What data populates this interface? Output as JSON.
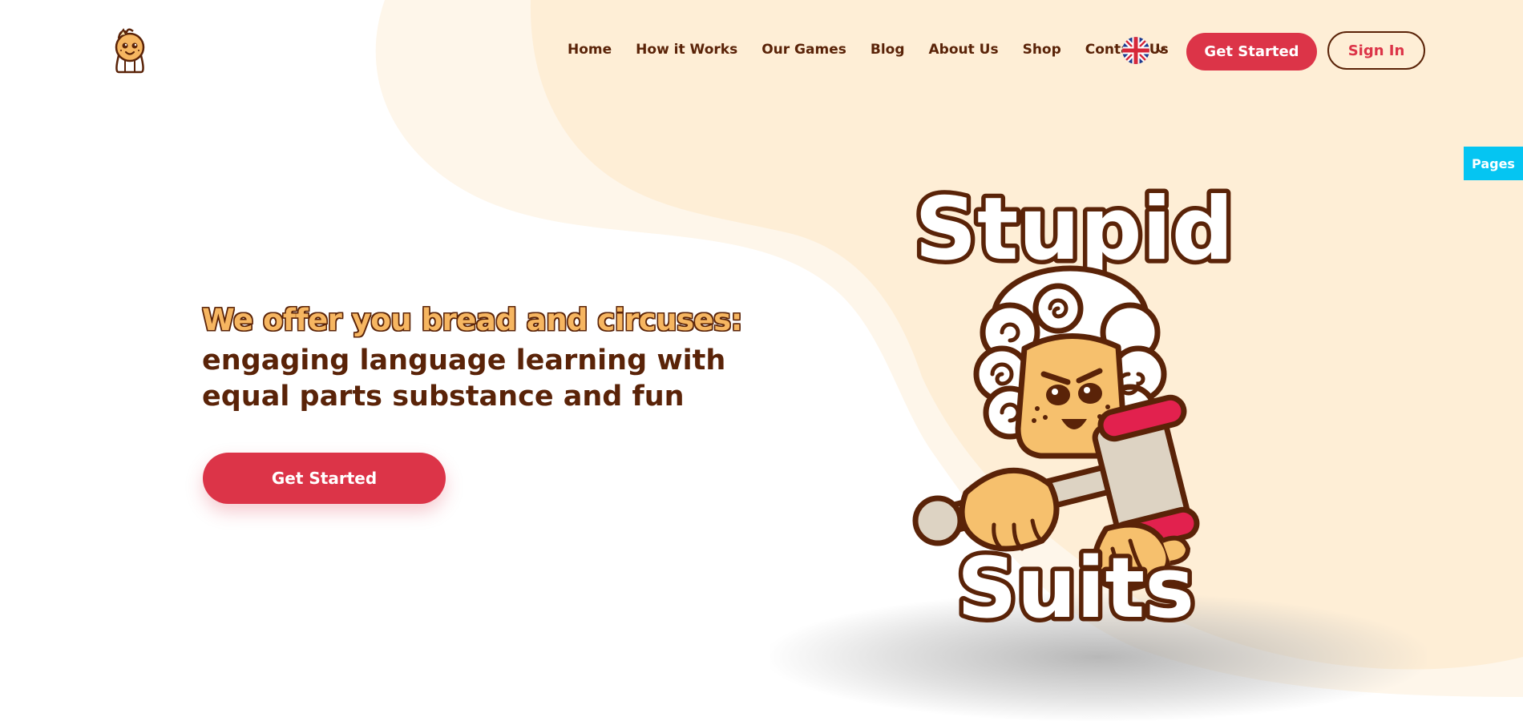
{
  "header": {
    "nav": [
      {
        "id": "home",
        "label": "Home"
      },
      {
        "id": "how-it-works",
        "label": "How it Works"
      },
      {
        "id": "our-games",
        "label": "Our Games"
      },
      {
        "id": "blog",
        "label": "Blog"
      },
      {
        "id": "about-us",
        "label": "About Us"
      },
      {
        "id": "shop",
        "label": "Shop"
      },
      {
        "id": "contact-us",
        "label": "Contact Us"
      }
    ],
    "language_icon": "uk-flag-icon",
    "get_started_label": "Get Started",
    "sign_in_label": "Sign In"
  },
  "side_tab": {
    "label": "Pages"
  },
  "hero": {
    "tagline": "We offer you bread and circuses:",
    "line1": "engaging language learning with",
    "line2": "equal parts substance and fun",
    "cta_label": "Get Started"
  },
  "mascot": {
    "word_top": "Stupid",
    "word_bottom": "Suits"
  },
  "colors": {
    "brand_red": "#dc3448",
    "text_brown": "#5a2308",
    "cream": "#feeed6",
    "cream_light": "#fef6ea",
    "accent_orange": "#f6b661",
    "pages_cyan": "#05c5f2"
  }
}
